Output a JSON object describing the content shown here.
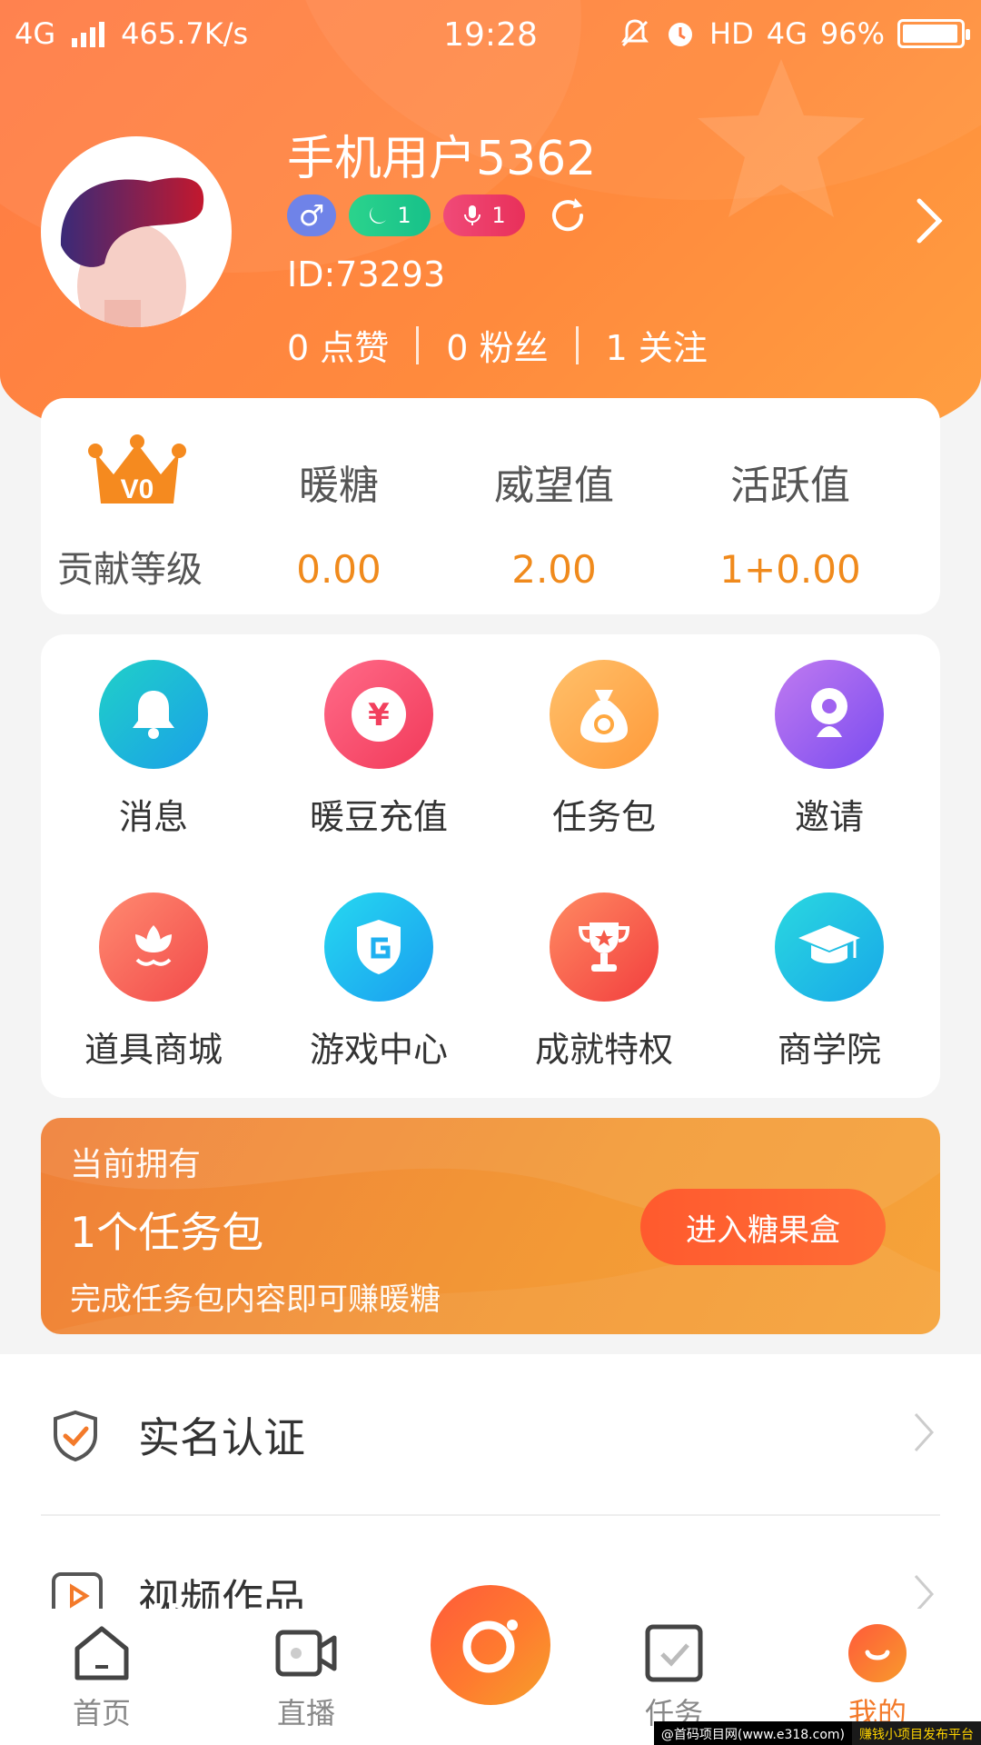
{
  "status_bar": {
    "network": "4G",
    "speed": "465.7K/s",
    "time": "19:28",
    "hd": "HD",
    "network_right": "4G",
    "battery": "96%",
    "battery_level": 0.96
  },
  "profile": {
    "username": "手机用户5362",
    "badges": {
      "gender_symbol": "♂",
      "moon_count": "1",
      "mic_count": "1"
    },
    "id_text": "ID:73293",
    "stats": [
      {
        "count": "0",
        "label": "点赞"
      },
      {
        "count": "0",
        "label": "粉丝"
      },
      {
        "count": "1",
        "label": "关注"
      }
    ]
  },
  "level_card": {
    "crown_text": "V0",
    "title": "贡献等级",
    "columns": [
      {
        "label": "暖糖",
        "value": "0.00"
      },
      {
        "label": "威望值",
        "value": "2.00"
      },
      {
        "label": "活跃值",
        "value": "1+0.00"
      }
    ]
  },
  "grid": [
    {
      "label": "消息",
      "icon": "bell-icon"
    },
    {
      "label": "暖豆充值",
      "icon": "yen-icon"
    },
    {
      "label": "任务包",
      "icon": "money-bag-icon"
    },
    {
      "label": "邀请",
      "icon": "invite-icon"
    },
    {
      "label": "道具商城",
      "icon": "flower-icon"
    },
    {
      "label": "游戏中心",
      "icon": "shield-g-icon"
    },
    {
      "label": "成就特权",
      "icon": "trophy-icon"
    },
    {
      "label": "商学院",
      "icon": "graduation-cap-icon"
    }
  ],
  "promo": {
    "line1": "当前拥有",
    "line2": "1个任务包",
    "line3": "完成任务包内容即可赚暖糖",
    "button": "进入糖果盒"
  },
  "list": [
    {
      "label": "实名认证",
      "icon": "shield-check-icon"
    },
    {
      "label": "视频作品",
      "icon": "video-play-icon"
    }
  ],
  "tabbar": {
    "home": "首页",
    "live": "直播",
    "tasks": "任务",
    "mine": "我的"
  },
  "watermark": {
    "left": "@首码项目网(www.e318.com)",
    "right": "赚钱小项目发布平台"
  },
  "colors": {
    "accent": "#ff7b45",
    "value_orange": "#f08a1c",
    "active_tab": "#f37a2a"
  }
}
